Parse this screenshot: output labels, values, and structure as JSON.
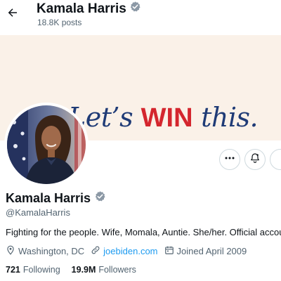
{
  "header": {
    "title": "Kamala Harris",
    "posts_count": "18.8K posts"
  },
  "banner": {
    "slogan_part1": "Let’s ",
    "slogan_highlight": "WIN",
    "slogan_part2": " this."
  },
  "profile": {
    "name": "Kamala Harris",
    "handle": "@KamalaHarris",
    "bio": "Fighting for the people. Wife, Momala, Auntie. She/her. Official account",
    "location": "Washington, DC",
    "website": "joebiden.com",
    "joined": "Joined April 2009",
    "following_count": "721",
    "following_label": "Following",
    "followers_count": "19.9M",
    "followers_label": "Followers"
  },
  "icons": [
    "back-arrow-icon",
    "verified-badge-icon",
    "more-icon",
    "notification-bell-icon",
    "location-pin-icon",
    "link-icon",
    "calendar-icon"
  ],
  "colors": {
    "link": "#1d9bf0",
    "verified": "#8b98a5",
    "slogan_blue": "#1f3b76",
    "slogan_red": "#d4262e",
    "banner_bg": "#faf1e8"
  }
}
